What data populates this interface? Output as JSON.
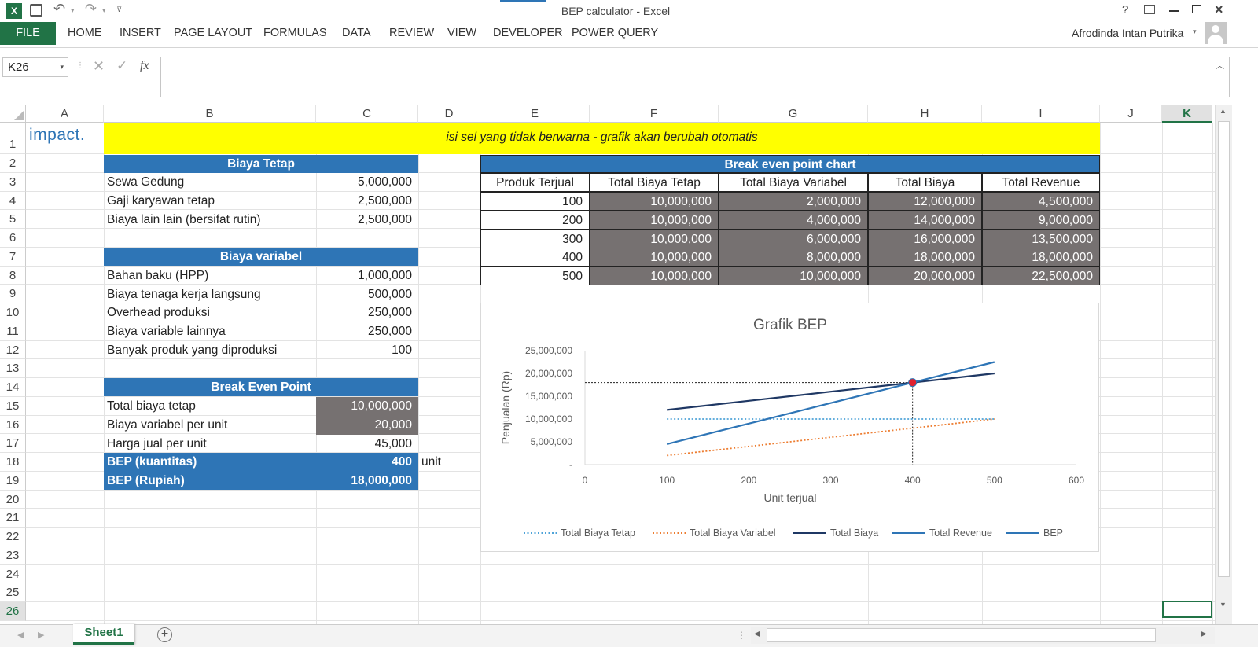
{
  "titlebar": {
    "title": "BEP calculator - Excel",
    "help": "?",
    "user": "Afrodinda Intan Putrika"
  },
  "ribbon": {
    "file": "FILE",
    "tabs": [
      "HOME",
      "INSERT",
      "PAGE LAYOUT",
      "FORMULAS",
      "DATA",
      "REVIEW",
      "VIEW",
      "DEVELOPER",
      "POWER QUERY"
    ]
  },
  "formula_bar": {
    "name_box": "K26",
    "fx": "fx",
    "value": ""
  },
  "columns": [
    "A",
    "B",
    "C",
    "D",
    "E",
    "F",
    "G",
    "H",
    "I",
    "J",
    "K"
  ],
  "rows": [
    "1",
    "2",
    "3",
    "4",
    "5",
    "6",
    "7",
    "8",
    "9",
    "10",
    "11",
    "12",
    "13",
    "14",
    "15",
    "16",
    "17",
    "18",
    "19",
    "20",
    "21",
    "22",
    "23",
    "24",
    "25",
    "26"
  ],
  "logo": "impact.",
  "banner": "isi sel yang tidak berwarna - grafik akan berubah otomatis",
  "biaya_tetap": {
    "header": "Biaya Tetap",
    "items": [
      {
        "label": "Sewa Gedung",
        "value": "5,000,000"
      },
      {
        "label": "Gaji karyawan tetap",
        "value": "2,500,000"
      },
      {
        "label": "Biaya lain lain (bersifat rutin)",
        "value": "2,500,000"
      }
    ]
  },
  "biaya_variabel": {
    "header": "Biaya variabel",
    "items": [
      {
        "label": "Bahan baku (HPP)",
        "value": "1,000,000"
      },
      {
        "label": "Biaya tenaga kerja langsung",
        "value": "500,000"
      },
      {
        "label": "Overhead produksi",
        "value": "250,000"
      },
      {
        "label": "Biaya variable lainnya",
        "value": "250,000"
      },
      {
        "label": "Banyak produk yang diproduksi",
        "value": "100"
      }
    ]
  },
  "bep": {
    "header": "Break Even Point",
    "items": [
      {
        "label": "Total biaya tetap",
        "value": "10,000,000"
      },
      {
        "label": "Biaya variabel per unit",
        "value": "20,000"
      },
      {
        "label": "Harga jual per unit",
        "value": "45,000"
      }
    ],
    "qty_label": "BEP (kuantitas)",
    "qty_value": "400",
    "qty_unit": "unit",
    "rp_label": "BEP (Rupiah)",
    "rp_value": "18,000,000"
  },
  "bep_table": {
    "header": "Break even point chart",
    "columns": [
      "Produk Terjual",
      "Total Biaya Tetap",
      "Total Biaya Variabel",
      "Total Biaya",
      "Total Revenue"
    ],
    "rows": [
      [
        "100",
        "10,000,000",
        "2,000,000",
        "12,000,000",
        "4,500,000"
      ],
      [
        "200",
        "10,000,000",
        "4,000,000",
        "14,000,000",
        "9,000,000"
      ],
      [
        "300",
        "10,000,000",
        "6,000,000",
        "16,000,000",
        "13,500,000"
      ],
      [
        "400",
        "10,000,000",
        "8,000,000",
        "18,000,000",
        "18,000,000"
      ],
      [
        "500",
        "10,000,000",
        "10,000,000",
        "20,000,000",
        "22,500,000"
      ]
    ]
  },
  "chart_data": {
    "type": "line",
    "title": "Grafik BEP",
    "xlabel": "Unit terjual",
    "ylabel": "Penjualan (Rp)",
    "x_ticks": [
      "0",
      "100",
      "200",
      "300",
      "400",
      "500",
      "600"
    ],
    "y_ticks": [
      "-",
      "5,000,000",
      "10,000,000",
      "15,000,000",
      "20,000,000",
      "25,000,000"
    ],
    "xlim": [
      0,
      600
    ],
    "ylim": [
      0,
      25000000
    ],
    "x": [
      100,
      200,
      300,
      400,
      500
    ],
    "series": [
      {
        "name": "Total Biaya Tetap",
        "values": [
          10000000,
          10000000,
          10000000,
          10000000,
          10000000
        ],
        "color": "#4ea3d8",
        "dash": "dotted"
      },
      {
        "name": "Total Biaya Variabel",
        "values": [
          2000000,
          4000000,
          6000000,
          8000000,
          10000000
        ],
        "color": "#ed7d31",
        "dash": "dotted"
      },
      {
        "name": "Total Biaya",
        "values": [
          12000000,
          14000000,
          16000000,
          18000000,
          20000000
        ],
        "color": "#1f3864",
        "dash": "solid"
      },
      {
        "name": "Total Revenue",
        "values": [
          4500000,
          9000000,
          13500000,
          18000000,
          22500000
        ],
        "color": "#2e75b6",
        "dash": "solid"
      }
    ],
    "bep_series_name": "BEP",
    "bep_color": "#2e75b6",
    "bep_point": {
      "x": 400,
      "y": 18000000,
      "color": "#e0202e"
    },
    "legend_position": "bottom"
  },
  "sheet_tab": "Sheet1"
}
